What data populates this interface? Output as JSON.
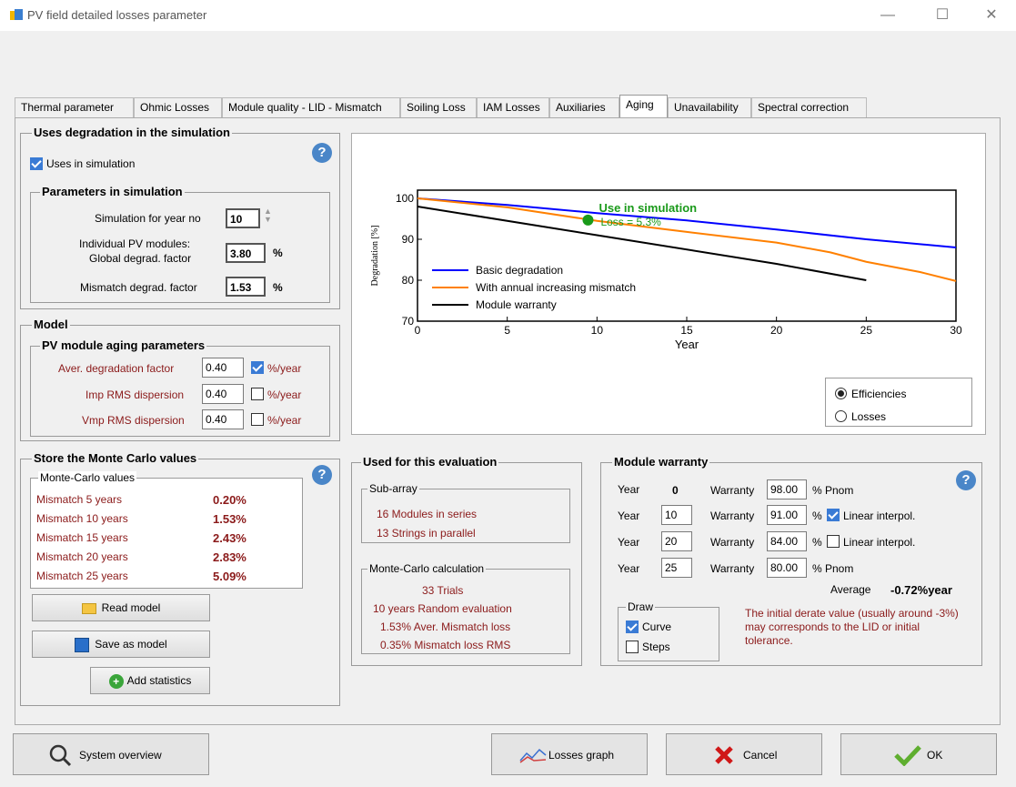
{
  "window": {
    "title": "PV field detailed losses parameter"
  },
  "tabs": [
    "Thermal parameter",
    "Ohmic Losses",
    "Module quality - LID - Mismatch",
    "Soiling Loss",
    "IAM Losses",
    "Auxiliaries",
    "Aging",
    "Unavailability",
    "Spectral correction"
  ],
  "active_tab": "Aging",
  "degradation": {
    "title": "Uses degradation in the simulation",
    "uses_label": "Uses in simulation",
    "params_title": "Parameters in simulation",
    "sim_year_label": "Simulation for year no",
    "sim_year_value": "10",
    "indiv_label_1": "Individual PV modules:",
    "indiv_label_2": "Global degrad. factor",
    "global_value": "3.80",
    "pct": "%",
    "mismatch_label": "Mismatch degrad. factor",
    "mismatch_value": "1.53"
  },
  "model": {
    "title": "Model",
    "sub_title": "PV module aging parameters",
    "rows": [
      {
        "label": "Aver. degradation factor",
        "value": "0.40",
        "unit": "%/year",
        "checked": true
      },
      {
        "label": "Imp RMS dispersion",
        "value": "0.40",
        "unit": "%/year",
        "checked": false
      },
      {
        "label": "Vmp RMS dispersion",
        "value": "0.40",
        "unit": "%/year",
        "checked": false
      }
    ]
  },
  "montecarlo": {
    "title": "Store the Monte Carlo values",
    "sub_title": "Monte-Carlo values",
    "rows": [
      {
        "label": "Mismatch  5 years",
        "value": "0.20%"
      },
      {
        "label": "Mismatch 10 years",
        "value": "1.53%"
      },
      {
        "label": "Mismatch 15 years",
        "value": "2.43%"
      },
      {
        "label": "Mismatch 20 years",
        "value": "2.83%"
      },
      {
        "label": "Mismatch 25 years",
        "value": "5.09%"
      }
    ],
    "read_model": "Read model",
    "save_model": "Save as model",
    "add_stats": "Add statistics"
  },
  "chart_data": {
    "type": "line",
    "title": "",
    "xlabel": "Year",
    "ylabel": "Degradation [%]",
    "xlim": [
      0,
      30
    ],
    "ylim": [
      70,
      102
    ],
    "xticks": [
      "0",
      "5",
      "10",
      "15",
      "20",
      "25",
      "30"
    ],
    "yticks": [
      "70",
      "80",
      "90",
      "100"
    ],
    "annotation_1": "Use in simulation",
    "annotation_2": "Loss = 5.3%",
    "marker": {
      "x": 9.5,
      "y": 94.7
    },
    "legend_position": "bottom-left",
    "series": [
      {
        "name": "Basic degradation",
        "color": "#0000ff",
        "x": [
          0,
          5,
          10,
          15,
          20,
          25,
          30
        ],
        "y": [
          100,
          98.4,
          96.4,
          94.6,
          92.4,
          90.0,
          88.0
        ]
      },
      {
        "name": "With annual increasing mismatch",
        "color": "#ff8000",
        "x": [
          0,
          5,
          10,
          15,
          20,
          23,
          25,
          28,
          30
        ],
        "y": [
          100,
          97.8,
          94.5,
          91.8,
          89.2,
          86.8,
          84.5,
          82.0,
          79.8
        ]
      },
      {
        "name": "Module warranty",
        "color": "#000000",
        "x": [
          0,
          10,
          20,
          25
        ],
        "y": [
          98,
          91,
          84,
          80
        ]
      }
    ]
  },
  "display_mode": {
    "options": [
      "Efficiencies",
      "Losses"
    ],
    "selected": "Efficiencies"
  },
  "evaluation": {
    "title": "Used for this evaluation",
    "subarray_title": "Sub-array",
    "modules": "16  Modules in series",
    "strings": "13  Strings in parallel",
    "mc_title": "Monte-Carlo calculation",
    "mc_lines": [
      "33 Trials",
      "10 years  Random evaluation",
      "1.53%  Aver. Mismatch loss",
      "0.35%  Mismatch loss RMS"
    ]
  },
  "warranty": {
    "title": "Module warranty",
    "year_label": "Year",
    "warranty_label": "Warranty",
    "rows": [
      {
        "year": "0",
        "value": "98.00",
        "suffix": "% Pnom",
        "interp": null
      },
      {
        "year": "10",
        "value": "91.00",
        "suffix": "%",
        "interp": "Linear interpol.",
        "checked": true
      },
      {
        "year": "20",
        "value": "84.00",
        "suffix": "%",
        "interp": "Linear interpol.",
        "checked": false
      },
      {
        "year": "25",
        "value": "80.00",
        "suffix": "% Pnom",
        "interp": null
      }
    ],
    "average_label": "Average",
    "average_value": "-0.72%year",
    "draw_title": "Draw",
    "curve": "Curve",
    "steps": "Steps",
    "note": "The initial derate value (usually around -3%) may corresponds to the LID or initial tolerance."
  },
  "footer": {
    "system_overview": "System overview",
    "losses_graph": "Losses graph",
    "cancel": "Cancel",
    "ok": "OK"
  }
}
